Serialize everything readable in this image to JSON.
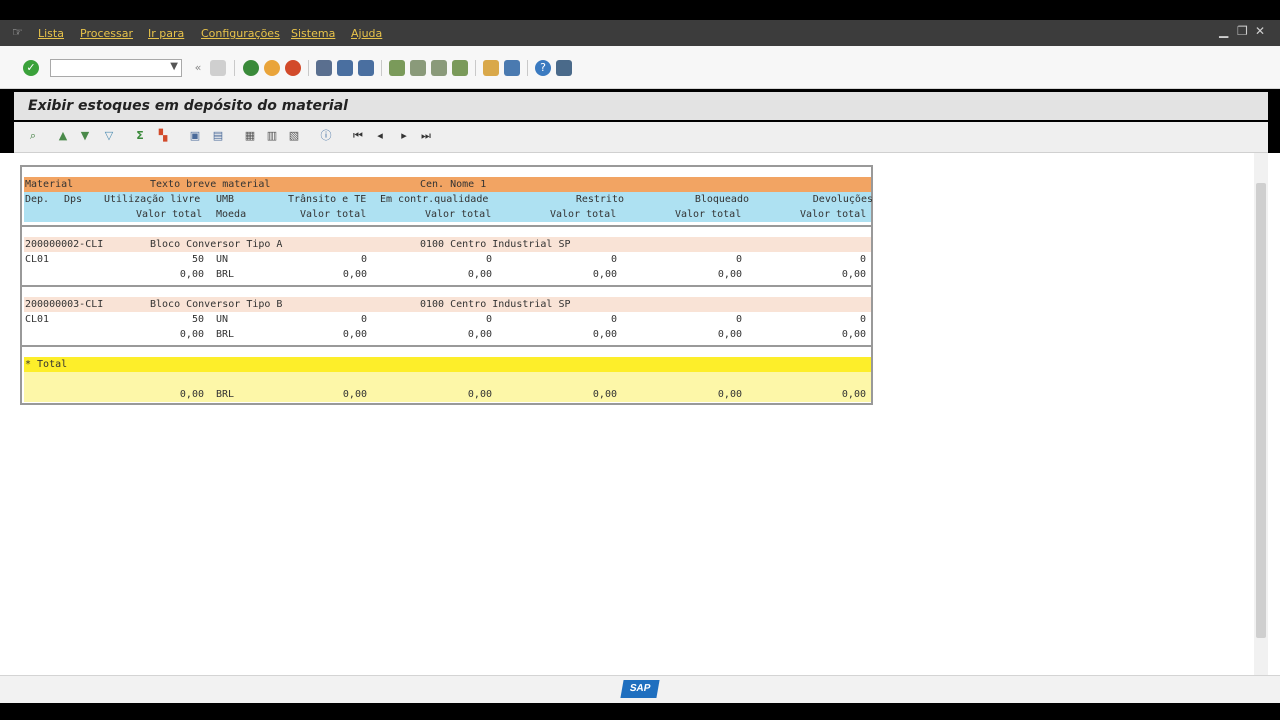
{
  "menubar": {
    "items": [
      "Lista",
      "Processar",
      "Ir para",
      "Configurações",
      "Sistema",
      "Ajuda"
    ]
  },
  "page": {
    "title": "Exibir estoques em depósito do material"
  },
  "table": {
    "header1": {
      "material": "Material",
      "texto": "Texto breve material",
      "cen": "Cen. Nome 1"
    },
    "header2": {
      "dep": "Dep.",
      "dps": "Dps",
      "util": "Utilização livre",
      "umb": "UMB",
      "transito": "Trânsito e TE",
      "qualidade": "Em contr.qualidade",
      "restrito": "Restrito",
      "bloqueado": "Bloqueado",
      "devolucoes": "Devoluções"
    },
    "header3": {
      "valor_total_1": "Valor total",
      "moeda": "Moeda",
      "valor_total_2": "Valor total",
      "valor_total_3": "Valor total",
      "valor_total_4": "Valor total",
      "valor_total_5": "Valor total",
      "valor_total_6": "Valor total"
    },
    "groups": [
      {
        "material": "200000002-CLI",
        "texto": "Bloco Conversor Tipo A",
        "centro": "0100 Centro Industrial SP",
        "dep": "CL01",
        "util": "50",
        "umb": "UN",
        "transito": "0",
        "qualidade": "0",
        "restrito": "0",
        "bloqueado": "0",
        "devolucoes": "0",
        "valor_util": "0,00",
        "moeda": "BRL",
        "v2": "0,00",
        "v3": "0,00",
        "v4": "0,00",
        "v5": "0,00",
        "v6": "0,00"
      },
      {
        "material": "200000003-CLI",
        "texto": "Bloco Conversor Tipo B",
        "centro": "0100 Centro Industrial SP",
        "dep": "CL01",
        "util": "50",
        "umb": "UN",
        "transito": "0",
        "qualidade": "0",
        "restrito": "0",
        "bloqueado": "0",
        "devolucoes": "0",
        "valor_util": "0,00",
        "moeda": "BRL",
        "v2": "0,00",
        "v3": "0,00",
        "v4": "0,00",
        "v5": "0,00",
        "v6": "0,00"
      }
    ],
    "total": {
      "label": "* Total",
      "valor_util": "0,00",
      "moeda": "BRL",
      "v2": "0,00",
      "v3": "0,00",
      "v4": "0,00",
      "v5": "0,00",
      "v6": "0,00"
    }
  },
  "statusbar": {
    "logo": "SAP"
  },
  "colors": {
    "header_orange": "#f2a463",
    "header_blue": "#aee1f2",
    "material_row": "#f9e3d6",
    "total_yellow": "#fdee2a",
    "menu_text": "#e8c34a"
  }
}
